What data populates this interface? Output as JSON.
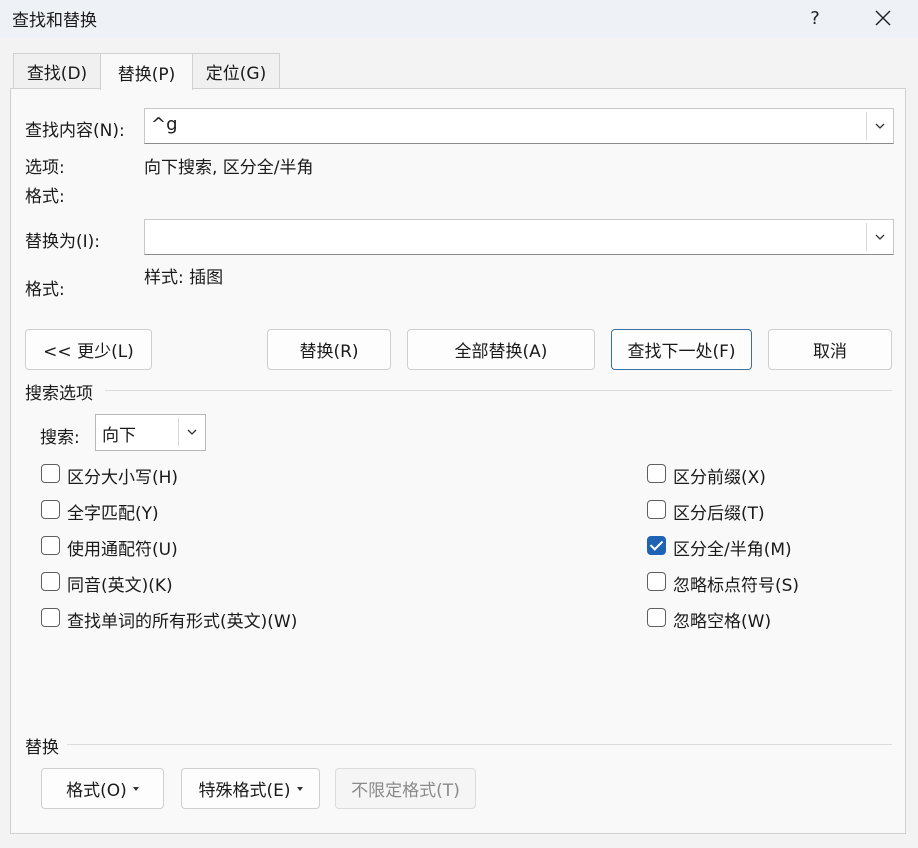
{
  "window": {
    "title": "查找和替换",
    "help": "?",
    "close": "✕"
  },
  "tabs": [
    {
      "label": "查找(D)"
    },
    {
      "label": "替换(P)"
    },
    {
      "label": "定位(G)"
    }
  ],
  "find": {
    "label": "查找内容(N):",
    "value": "^g"
  },
  "options": {
    "label": "选项:",
    "value": "向下搜索, 区分全/半角"
  },
  "find_format": {
    "label": "格式:"
  },
  "replace": {
    "label": "替换为(I):",
    "value": ""
  },
  "replace_format": {
    "label": "格式:",
    "value": "样式: 插图"
  },
  "buttons": {
    "less": "<< 更少(L)",
    "replace": "替换(R)",
    "replace_all": "全部替换(A)",
    "find_next": "查找下一处(F)",
    "cancel": "取消"
  },
  "search_options": {
    "title": "搜索选项",
    "search_label": "搜索:",
    "search_value": "向下",
    "left": [
      {
        "label": "区分大小写(H)",
        "checked": false
      },
      {
        "label": "全字匹配(Y)",
        "checked": false
      },
      {
        "label": "使用通配符(U)",
        "checked": false
      },
      {
        "label": "同音(英文)(K)",
        "checked": false
      },
      {
        "label": "查找单词的所有形式(英文)(W)",
        "checked": false
      }
    ],
    "right": [
      {
        "label": "区分前缀(X)",
        "checked": false
      },
      {
        "label": "区分后缀(T)",
        "checked": false
      },
      {
        "label": "区分全/半角(M)",
        "checked": true
      },
      {
        "label": "忽略标点符号(S)",
        "checked": false
      },
      {
        "label": "忽略空格(W)",
        "checked": false
      }
    ]
  },
  "replace_section": {
    "title": "替换",
    "format": "格式(O)",
    "special": "特殊格式(E)",
    "no_format": "不限定格式(T)"
  },
  "colors": {
    "accent": "#1f64b4",
    "titlebar": "#eef2f7"
  },
  "icons": {
    "dropdown": "chevron-down-icon",
    "check": "check-icon",
    "close": "close-icon",
    "help": "help-icon"
  }
}
